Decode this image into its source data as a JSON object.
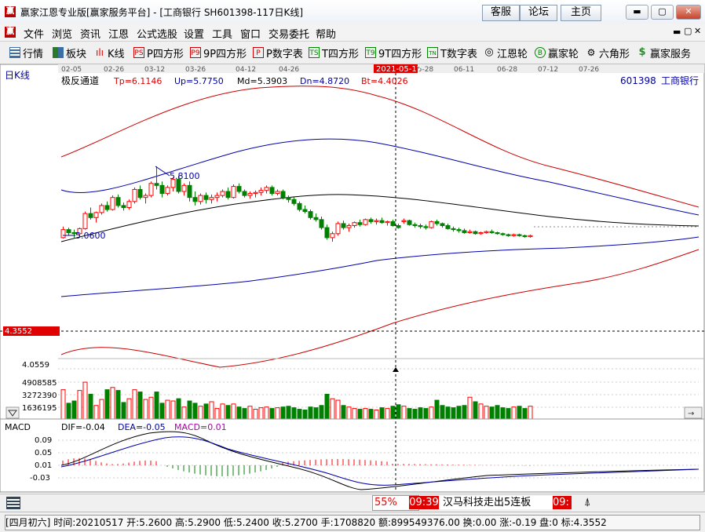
{
  "window": {
    "title": "赢家江恩专业版[赢家服务平台] - [工商银行  SH601398-117日K线]",
    "logo_text": "赢",
    "buttons": [
      "客服",
      "论坛",
      "主页"
    ],
    "controls": [
      "▬",
      "▢",
      "✕"
    ]
  },
  "menu": {
    "items": [
      "文件",
      "浏览",
      "资讯",
      "江恩",
      "公式选股",
      "设置",
      "工具",
      "窗口",
      "交易委托",
      "帮助"
    ],
    "right_controls": [
      "▬",
      "▢",
      "✕"
    ]
  },
  "toolbar": {
    "items": [
      {
        "label": "行情",
        "icon": "grid-icon"
      },
      {
        "label": "板块",
        "icon": "blocks-icon"
      },
      {
        "label": "K线",
        "icon": "candle-icon"
      },
      {
        "label": "P四方形",
        "icon": "ps-icon",
        "glyph": "PS"
      },
      {
        "label": "9P四方形",
        "icon": "p9-icon",
        "glyph": "P9"
      },
      {
        "label": "P数字表",
        "icon": "pt-icon",
        "glyph": "P"
      },
      {
        "label": "T四方形",
        "icon": "ts-icon",
        "glyph": "TS"
      },
      {
        "label": "9T四方形",
        "icon": "t9-icon",
        "glyph": "T9"
      },
      {
        "label": "T数字表",
        "icon": "tn-icon",
        "glyph": "TN"
      },
      {
        "label": "江恩轮",
        "icon": "wheel-icon",
        "glyph": "◎"
      },
      {
        "label": "赢家轮",
        "icon": "big-icon",
        "glyph": "B"
      },
      {
        "label": "六角形",
        "icon": "hexagon-icon",
        "glyph": "⚙"
      },
      {
        "label": "赢家服务",
        "icon": "dollar-icon",
        "glyph": "$"
      }
    ]
  },
  "chart": {
    "period_label": "日K线",
    "indicator_name": "极反通道",
    "params": {
      "Tp": "Tp=6.1146",
      "Up": "Up=5.7750",
      "Md": "Md=5.3903",
      "Dn": "Dn=4.8720",
      "Bt": "Bt=4.4026"
    },
    "symbol": "601398",
    "stock_name": "工商银行",
    "date_axis": [
      "02-05",
      "02-26",
      "03-12",
      "03-26",
      "04-12",
      "04-26",
      "2021-05-17",
      "05-28",
      "06-11",
      "06-28",
      "07-12",
      "07-26"
    ],
    "highlight_date": "2021-05-17",
    "price_marker": "4.3552",
    "high_label": "5.8100",
    "low_label": "5.0600",
    "vol_labels": [
      "4.0559",
      "4908585",
      "3272390",
      "1636195"
    ],
    "colors": {
      "up": "#ff0000",
      "down": "#008000",
      "upper_band": "#cc0000",
      "mid_band": "#0000aa",
      "center": "#000000",
      "highlight": "#e00000"
    }
  },
  "chart_data": {
    "type": "candlestick",
    "dates": [
      "2021-02-05",
      "2021-02-08",
      "2021-02-09",
      "2021-02-10",
      "2021-02-18",
      "2021-02-19",
      "2021-02-22",
      "2021-02-23",
      "2021-02-24",
      "2021-02-25",
      "2021-02-26",
      "2021-03-01",
      "2021-03-02",
      "2021-03-03",
      "2021-03-04",
      "2021-03-05",
      "2021-03-08",
      "2021-03-09",
      "2021-03-10",
      "2021-03-11",
      "2021-03-12",
      "2021-03-15",
      "2021-03-16",
      "2021-03-17",
      "2021-03-18",
      "2021-03-19",
      "2021-03-22",
      "2021-03-23",
      "2021-03-24",
      "2021-03-25",
      "2021-03-26",
      "2021-03-29",
      "2021-03-30",
      "2021-03-31",
      "2021-04-01",
      "2021-04-02",
      "2021-04-06",
      "2021-04-07",
      "2021-04-08",
      "2021-04-09",
      "2021-04-12",
      "2021-04-13",
      "2021-04-14",
      "2021-04-15",
      "2021-04-16",
      "2021-04-19",
      "2021-04-20",
      "2021-04-21",
      "2021-04-22",
      "2021-04-23",
      "2021-04-26",
      "2021-04-27",
      "2021-04-28",
      "2021-04-29",
      "2021-04-30",
      "2021-05-06",
      "2021-05-07",
      "2021-05-10",
      "2021-05-11",
      "2021-05-12",
      "2021-05-13",
      "2021-05-14",
      "2021-05-17",
      "2021-05-18",
      "2021-05-19",
      "2021-05-20",
      "2021-05-21",
      "2021-05-24",
      "2021-05-25",
      "2021-05-26",
      "2021-05-27",
      "2021-05-28",
      "2021-05-31",
      "2021-06-01",
      "2021-06-02",
      "2021-06-03",
      "2021-06-04",
      "2021-06-07",
      "2021-06-08",
      "2021-06-09",
      "2021-06-10",
      "2021-06-11",
      "2021-06-15",
      "2021-06-16",
      "2021-06-17",
      "2021-06-18"
    ],
    "ohlc": [
      [
        5.1,
        5.21,
        5.09,
        5.18
      ],
      [
        5.18,
        5.2,
        5.12,
        5.15
      ],
      [
        5.15,
        5.18,
        5.1,
        5.14
      ],
      [
        5.14,
        5.2,
        5.12,
        5.19
      ],
      [
        5.19,
        5.36,
        5.18,
        5.34
      ],
      [
        5.34,
        5.4,
        5.28,
        5.3
      ],
      [
        5.3,
        5.36,
        5.25,
        5.35
      ],
      [
        5.35,
        5.44,
        5.33,
        5.42
      ],
      [
        5.42,
        5.46,
        5.36,
        5.38
      ],
      [
        5.38,
        5.52,
        5.37,
        5.5
      ],
      [
        5.5,
        5.53,
        5.4,
        5.42
      ],
      [
        5.42,
        5.45,
        5.37,
        5.4
      ],
      [
        5.4,
        5.48,
        5.38,
        5.46
      ],
      [
        5.46,
        5.6,
        5.44,
        5.58
      ],
      [
        5.58,
        5.62,
        5.48,
        5.5
      ],
      [
        5.5,
        5.54,
        5.44,
        5.52
      ],
      [
        5.52,
        5.66,
        5.5,
        5.64
      ],
      [
        5.64,
        5.81,
        5.58,
        5.62
      ],
      [
        5.62,
        5.66,
        5.5,
        5.54
      ],
      [
        5.54,
        5.62,
        5.52,
        5.6
      ],
      [
        5.6,
        5.7,
        5.56,
        5.68
      ],
      [
        5.68,
        5.72,
        5.54,
        5.56
      ],
      [
        5.56,
        5.64,
        5.52,
        5.62
      ],
      [
        5.62,
        5.66,
        5.46,
        5.5
      ],
      [
        5.5,
        5.56,
        5.42,
        5.46
      ],
      [
        5.46,
        5.54,
        5.43,
        5.52
      ],
      [
        5.52,
        5.55,
        5.44,
        5.48
      ],
      [
        5.48,
        5.53,
        5.44,
        5.5
      ],
      [
        5.5,
        5.55,
        5.46,
        5.52
      ],
      [
        5.52,
        5.58,
        5.5,
        5.56
      ],
      [
        5.56,
        5.6,
        5.48,
        5.5
      ],
      [
        5.5,
        5.63,
        5.49,
        5.61
      ],
      [
        5.61,
        5.64,
        5.54,
        5.56
      ],
      [
        5.56,
        5.58,
        5.5,
        5.52
      ],
      [
        5.52,
        5.56,
        5.49,
        5.54
      ],
      [
        5.54,
        5.57,
        5.5,
        5.55
      ],
      [
        5.55,
        5.6,
        5.52,
        5.57
      ],
      [
        5.57,
        5.62,
        5.54,
        5.6
      ],
      [
        5.6,
        5.62,
        5.52,
        5.54
      ],
      [
        5.54,
        5.58,
        5.52,
        5.56
      ],
      [
        5.56,
        5.58,
        5.48,
        5.5
      ],
      [
        5.5,
        5.52,
        5.45,
        5.48
      ],
      [
        5.48,
        5.5,
        5.42,
        5.44
      ],
      [
        5.44,
        5.46,
        5.36,
        5.38
      ],
      [
        5.38,
        5.42,
        5.34,
        5.36
      ],
      [
        5.36,
        5.38,
        5.28,
        5.3
      ],
      [
        5.3,
        5.34,
        5.26,
        5.28
      ],
      [
        5.28,
        5.31,
        5.18,
        5.2
      ],
      [
        5.2,
        5.23,
        5.08,
        5.1
      ],
      [
        5.1,
        5.16,
        5.06,
        5.14
      ],
      [
        5.14,
        5.26,
        5.12,
        5.24
      ],
      [
        5.24,
        5.27,
        5.18,
        5.2
      ],
      [
        5.2,
        5.24,
        5.16,
        5.22
      ],
      [
        5.22,
        5.26,
        5.2,
        5.25
      ],
      [
        5.25,
        5.28,
        5.21,
        5.23
      ],
      [
        5.23,
        5.29,
        5.22,
        5.28
      ],
      [
        5.28,
        5.3,
        5.24,
        5.26
      ],
      [
        5.26,
        5.29,
        5.23,
        5.27
      ],
      [
        5.27,
        5.3,
        5.24,
        5.25
      ],
      [
        5.25,
        5.27,
        5.22,
        5.26
      ],
      [
        5.26,
        5.28,
        5.21,
        5.22
      ],
      [
        5.22,
        5.24,
        5.19,
        5.2
      ],
      [
        5.26,
        5.29,
        5.24,
        5.27
      ],
      [
        5.27,
        5.28,
        5.22,
        5.23
      ],
      [
        5.23,
        5.25,
        5.2,
        5.22
      ],
      [
        5.22,
        5.24,
        5.19,
        5.21
      ],
      [
        5.21,
        5.23,
        5.18,
        5.2
      ],
      [
        5.2,
        5.27,
        5.19,
        5.26
      ],
      [
        5.26,
        5.28,
        5.22,
        5.24
      ],
      [
        5.24,
        5.25,
        5.2,
        5.22
      ],
      [
        5.22,
        5.24,
        5.18,
        5.19
      ],
      [
        5.19,
        5.21,
        5.16,
        5.18
      ],
      [
        5.18,
        5.2,
        5.15,
        5.17
      ],
      [
        5.17,
        5.19,
        5.14,
        5.15
      ],
      [
        5.15,
        5.18,
        5.14,
        5.16
      ],
      [
        5.16,
        5.17,
        5.13,
        5.14
      ],
      [
        5.14,
        5.16,
        5.13,
        5.15
      ],
      [
        5.15,
        5.17,
        5.14,
        5.16
      ],
      [
        5.16,
        5.18,
        5.14,
        5.15
      ],
      [
        5.15,
        5.16,
        5.13,
        5.14
      ],
      [
        5.14,
        5.15,
        5.12,
        5.13
      ],
      [
        5.13,
        5.14,
        5.11,
        5.12
      ],
      [
        5.12,
        5.14,
        5.11,
        5.13
      ],
      [
        5.13,
        5.14,
        5.11,
        5.12
      ],
      [
        5.12,
        5.13,
        5.1,
        5.11
      ],
      [
        5.11,
        5.13,
        5.1,
        5.12
      ]
    ],
    "volume": [
      3900000,
      2100000,
      2400000,
      3800000,
      4900000,
      3300000,
      1800000,
      2600000,
      3900000,
      4200000,
      3800000,
      2200000,
      2700000,
      3900000,
      3600000,
      2600000,
      2900000,
      3600000,
      2100000,
      2500000,
      2400000,
      2700000,
      1600000,
      2400000,
      2100000,
      1700000,
      2000000,
      2300000,
      1400000,
      2000000,
      1800000,
      2000000,
      1600000,
      1400000,
      1700000,
      1300000,
      1500000,
      1600000,
      1400000,
      1500000,
      1600000,
      1700000,
      1500000,
      1300000,
      1200000,
      1600000,
      1500000,
      1800000,
      3300000,
      2700000,
      2500000,
      1800000,
      1600000,
      1400000,
      1300000,
      1400000,
      1300000,
      1200000,
      1500000,
      1400000,
      1700000,
      1900000,
      1708820,
      1400000,
      1300000,
      1500000,
      1400000,
      1600000,
      2500000,
      1800000,
      1600000,
      1500000,
      1700000,
      1800000,
      2900000,
      2300000,
      2000000,
      1700000,
      1600000,
      1800000,
      1500000,
      1400000,
      1600000,
      1700000,
      1400000,
      1700000
    ],
    "bands": {
      "upper_top": "Tp",
      "upper": "Up",
      "mid": "Md",
      "lower": "Dn",
      "bottom": "Bt"
    },
    "macd": {
      "name": "MACD",
      "dif": "DIF=-0.04",
      "dea": "DEA=-0.05",
      "macd": "MACD=0.01",
      "axis": [
        "0.09",
        "0.05",
        "0.01",
        "-0.03"
      ]
    }
  },
  "bottom_bar": {
    "percent": "55%",
    "time1": "09:39",
    "news": "汉马科技走出5连板",
    "time2": "09:",
    "icon": "alert-icon"
  },
  "status": {
    "lunar": "[四月初六]",
    "date": "时间:20210517",
    "open": "开:5.2600",
    "high": "高:5.2900",
    "low": "低:5.2400",
    "close": "收:5.2700",
    "vol": "手:1708820",
    "amount": "额:899549376.00",
    "turnover": "换:0.00",
    "change": "涨:-0.19",
    "line": "盘:0",
    "mark": "标:4.3552"
  }
}
